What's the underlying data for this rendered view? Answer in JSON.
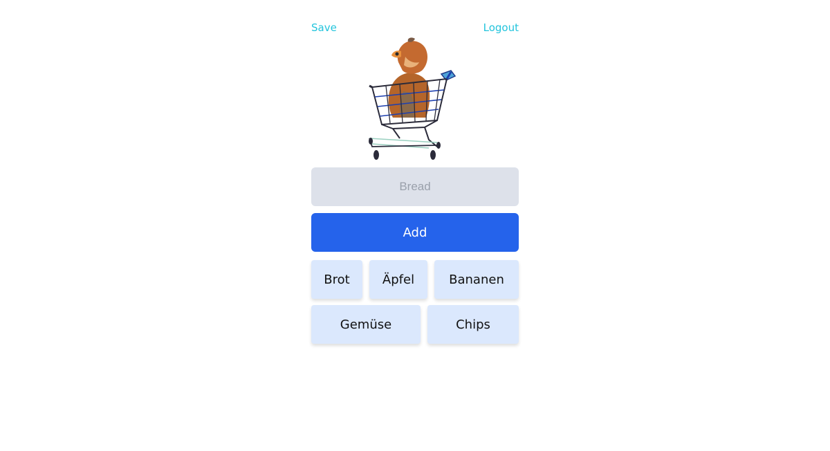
{
  "topbar": {
    "save_label": "Save",
    "logout_label": "Logout"
  },
  "illustration": {
    "icon": "dog-in-shopping-cart-illustration"
  },
  "input": {
    "placeholder": "Bread",
    "value": ""
  },
  "add_button": {
    "label": "Add",
    "color": "#2563eb"
  },
  "items": [
    {
      "label": "Brot"
    },
    {
      "label": "Äpfel"
    },
    {
      "label": "Bananen"
    },
    {
      "label": "Gemüse"
    },
    {
      "label": "Chips"
    }
  ],
  "colors": {
    "link": "#22c4dc",
    "chip_bg": "#dbe8fd",
    "input_bg": "#dde1ea"
  }
}
